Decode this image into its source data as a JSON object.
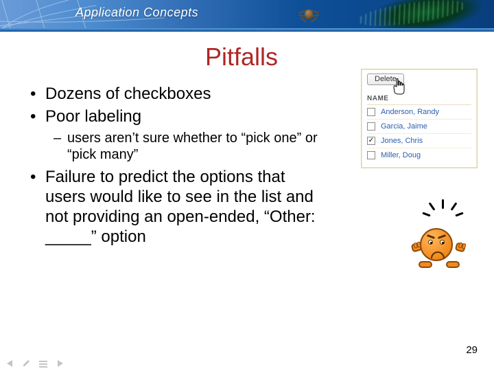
{
  "banner": {
    "title": "Application Concepts"
  },
  "slide": {
    "title": "Pitfalls",
    "bullets": [
      {
        "text": "Dozens of checkboxes"
      },
      {
        "text": "Poor labeling",
        "sub": [
          "users aren’t sure whether to “pick one” or “pick many”"
        ]
      },
      {
        "text": "Failure to predict the options that users would like to see in the list and not providing an open-ended, “Other: _____” option"
      }
    ]
  },
  "panel": {
    "delete_label": "Delete",
    "column_header": "NAME",
    "rows": [
      {
        "checked": false,
        "name": "Anderson, Randy"
      },
      {
        "checked": false,
        "name": "Garcia, Jaime"
      },
      {
        "checked": true,
        "name": "Jones, Chris"
      },
      {
        "checked": false,
        "name": "Miller, Doug"
      }
    ]
  },
  "page_number": "29",
  "nav": {
    "prev_icon": "◁",
    "pen_icon": "✛",
    "menu_icon": "▤",
    "next_icon": "▷"
  }
}
